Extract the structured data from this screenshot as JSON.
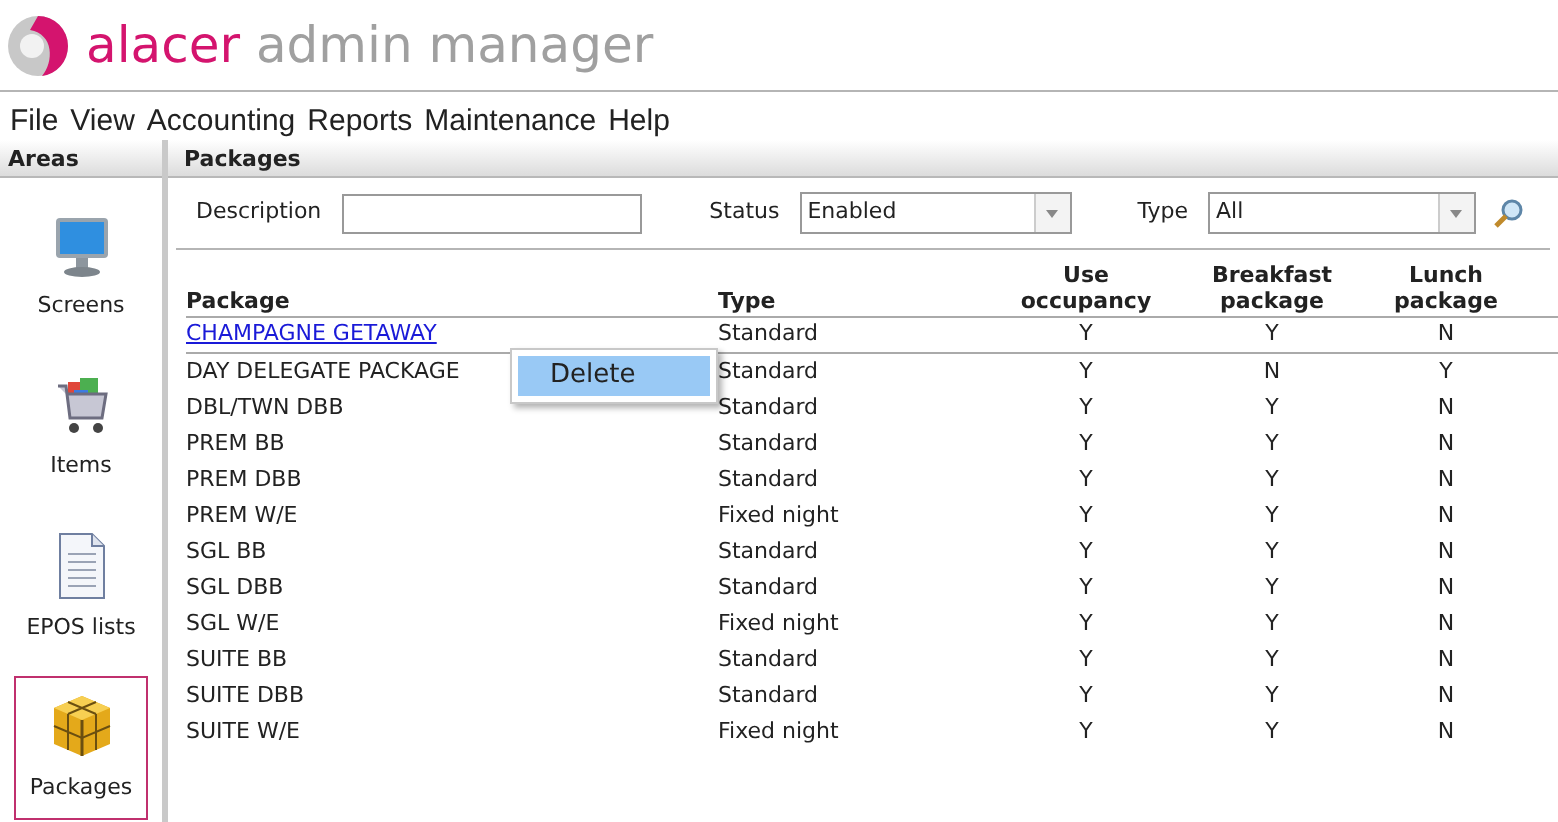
{
  "app": {
    "brand": "alacer",
    "product": "admin manager"
  },
  "menu": [
    "File",
    "View",
    "Accounting",
    "Reports",
    "Maintenance",
    "Help"
  ],
  "sidebar": {
    "title": "Areas",
    "items": [
      {
        "label": "Screens",
        "kind": "monitor",
        "selected": false
      },
      {
        "label": "Items",
        "kind": "cart",
        "selected": false
      },
      {
        "label": "EPOS lists",
        "kind": "document",
        "selected": false
      },
      {
        "label": "Packages",
        "kind": "package",
        "selected": true
      }
    ]
  },
  "panel": {
    "title": "Packages",
    "filters": {
      "description": {
        "label": "Description"
      },
      "status": {
        "label": "Status",
        "value": "Enabled"
      },
      "type": {
        "label": "Type",
        "value": "All"
      }
    },
    "table": {
      "columns": [
        "Package",
        "Type",
        "Use occupancy",
        "Breakfast package",
        "Lunch package"
      ],
      "rows": [
        {
          "cells": [
            "CHAMPAGNE GETAWAY",
            "Standard",
            "Y",
            "Y",
            "N"
          ],
          "selected": true
        },
        {
          "cells": [
            "DAY DELEGATE PACKAGE",
            "Standard",
            "Y",
            "N",
            "Y"
          ],
          "selected": false
        },
        {
          "cells": [
            "DBL/TWN DBB",
            "Standard",
            "Y",
            "Y",
            "N"
          ],
          "selected": false
        },
        {
          "cells": [
            "PREM BB",
            "Standard",
            "Y",
            "Y",
            "N"
          ],
          "selected": false
        },
        {
          "cells": [
            "PREM DBB",
            "Standard",
            "Y",
            "Y",
            "N"
          ],
          "selected": false
        },
        {
          "cells": [
            "PREM W/E",
            "Fixed night",
            "Y",
            "Y",
            "N"
          ],
          "selected": false
        },
        {
          "cells": [
            "SGL BB",
            "Standard",
            "Y",
            "Y",
            "N"
          ],
          "selected": false
        },
        {
          "cells": [
            "SGL DBB",
            "Standard",
            "Y",
            "Y",
            "N"
          ],
          "selected": false
        },
        {
          "cells": [
            "SGL W/E",
            "Fixed night",
            "Y",
            "Y",
            "N"
          ],
          "selected": false
        },
        {
          "cells": [
            "SUITE BB",
            "Standard",
            "Y",
            "Y",
            "N"
          ],
          "selected": false
        },
        {
          "cells": [
            "SUITE DBB",
            "Standard",
            "Y",
            "Y",
            "N"
          ],
          "selected": false
        },
        {
          "cells": [
            "SUITE W/E",
            "Fixed night",
            "Y",
            "Y",
            "N"
          ],
          "selected": false
        }
      ]
    },
    "context_menu": {
      "items": [
        "Delete"
      ]
    }
  }
}
